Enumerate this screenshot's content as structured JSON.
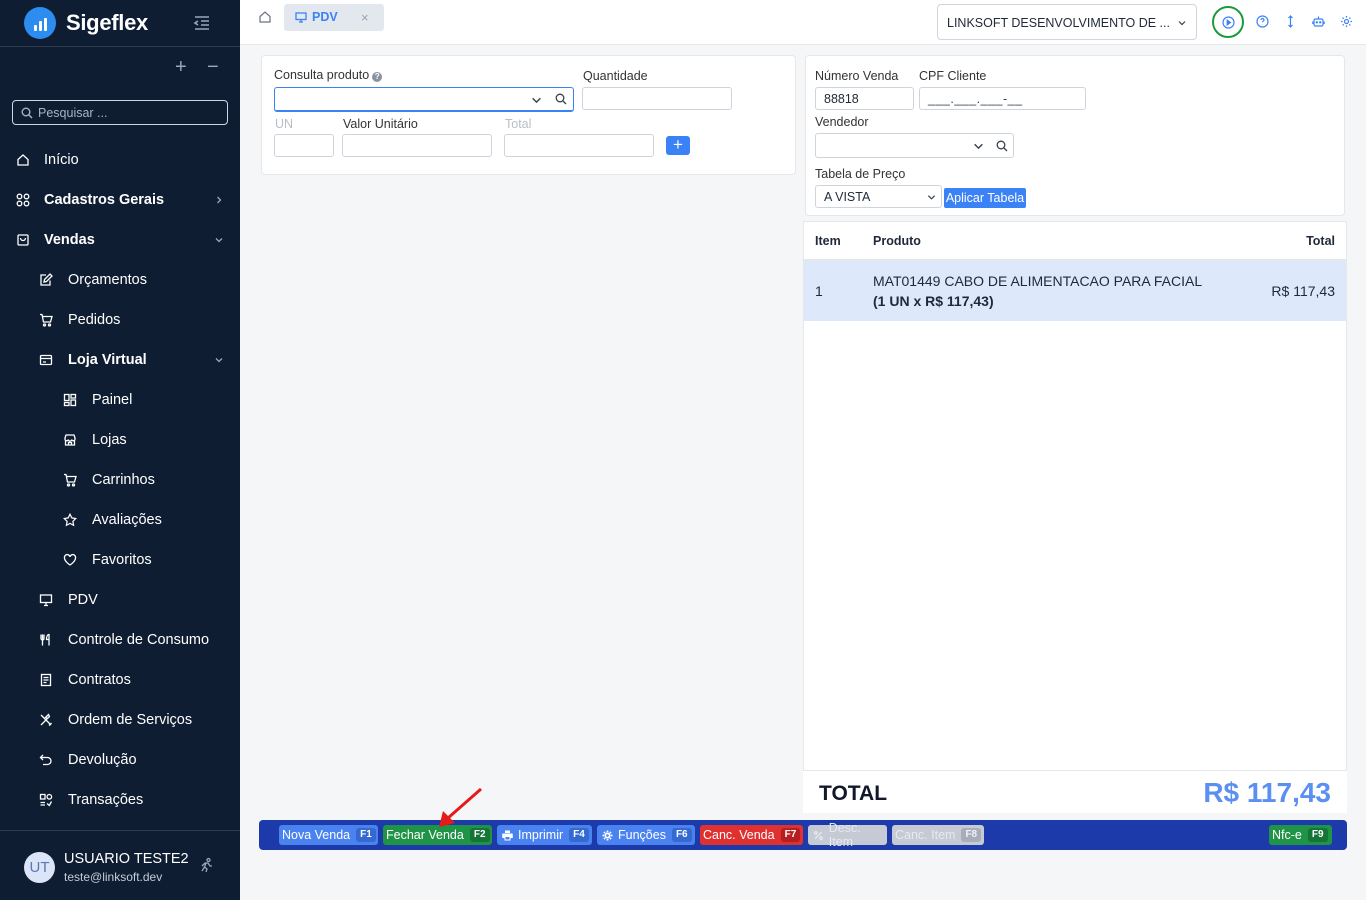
{
  "app": {
    "brand": "Sigeflex"
  },
  "sidebar": {
    "search_placeholder": "Pesquisar ...",
    "tools": {
      "add": "+",
      "remove": "−"
    },
    "items": [
      {
        "label": "Início",
        "icon": "home-icon"
      },
      {
        "label": "Cadastros Gerais",
        "icon": "grid-icon",
        "bold": true,
        "chevron": "right"
      },
      {
        "label": "Vendas",
        "icon": "bag-icon",
        "bold": true,
        "chevron": "down"
      },
      {
        "label": "Orçamentos",
        "icon": "edit-icon"
      },
      {
        "label": "Pedidos",
        "icon": "cart-icon"
      },
      {
        "label": "Loja Virtual",
        "icon": "card-icon",
        "bold": true,
        "chevron": "down"
      },
      {
        "label": "Painel",
        "icon": "dashboard-icon"
      },
      {
        "label": "Lojas",
        "icon": "store-icon"
      },
      {
        "label": "Carrinhos",
        "icon": "cart-icon"
      },
      {
        "label": "Avaliações",
        "icon": "star-icon"
      },
      {
        "label": "Favoritos",
        "icon": "heart-icon"
      },
      {
        "label": "PDV",
        "icon": "monitor-icon"
      },
      {
        "label": "Controle de Consumo",
        "icon": "utensils-icon"
      },
      {
        "label": "Contratos",
        "icon": "document-icon"
      },
      {
        "label": "Ordem de Serviços",
        "icon": "tools-icon"
      },
      {
        "label": "Devolução",
        "icon": "undo-icon"
      },
      {
        "label": "Transações",
        "icon": "transactions-icon"
      }
    ],
    "user": {
      "initials": "UT",
      "name": "USUARIO TESTE2",
      "email": "teste@linksoft.dev"
    }
  },
  "topbar": {
    "tab_label": "PDV",
    "tab_close": "×",
    "company": "LINKSOFT DESENVOLVIMENTO DE ..."
  },
  "product_form": {
    "consulta_label": "Consulta produto",
    "help_mark": "?",
    "quantidade_label": "Quantidade",
    "un_label": "UN",
    "valor_unitario_label": "Valor Unitário",
    "total_label": "Total",
    "add_label": "+"
  },
  "sale_form": {
    "numero_venda_label": "Número Venda",
    "numero_venda_value": "88818",
    "cpf_label": "CPF Cliente",
    "cpf_placeholder": "___.___.___-__",
    "vendedor_label": "Vendedor",
    "tabela_label": "Tabela de Preço",
    "tabela_value": "A VISTA",
    "apply_label": "Aplicar Tabela"
  },
  "items_table": {
    "headers": {
      "item": "Item",
      "produto": "Produto",
      "total": "Total"
    },
    "rows": [
      {
        "item": "1",
        "produto": "MAT01449 CABO DE ALIMENTACAO PARA FACIAL",
        "detail": "(1 UN x R$ 117,43)",
        "total": "R$ 117,43"
      }
    ]
  },
  "totals": {
    "label": "TOTAL",
    "value": "R$ 117,43"
  },
  "actions": [
    {
      "label": "Nova Venda",
      "key": "F1",
      "style": "blue"
    },
    {
      "label": "Fechar Venda",
      "key": "F2",
      "style": "green"
    },
    {
      "label": "Imprimir",
      "key": "F4",
      "style": "blue",
      "icon": "printer-icon"
    },
    {
      "label": "Funções",
      "key": "F6",
      "style": "blue",
      "icon": "gear-icon"
    },
    {
      "label": "Canc. Venda",
      "key": "F7",
      "style": "red"
    },
    {
      "label": "Desc. Item",
      "key": "",
      "style": "disabled",
      "icon": "percent-icon"
    },
    {
      "label": "Canc. Item",
      "key": "F8",
      "style": "disabled"
    },
    {
      "label": "Nfc-e",
      "key": "F9",
      "style": "green"
    }
  ],
  "colors": {
    "sidebar_bg": "#0f1d33",
    "accent": "#3b82f6",
    "action_bar": "#1c3aa9",
    "success": "#1f9446",
    "danger": "#e03131",
    "highlight_row": "#dde8fb",
    "total_value": "#5b8ff0",
    "annotation_arrow": "#e51b1b"
  }
}
